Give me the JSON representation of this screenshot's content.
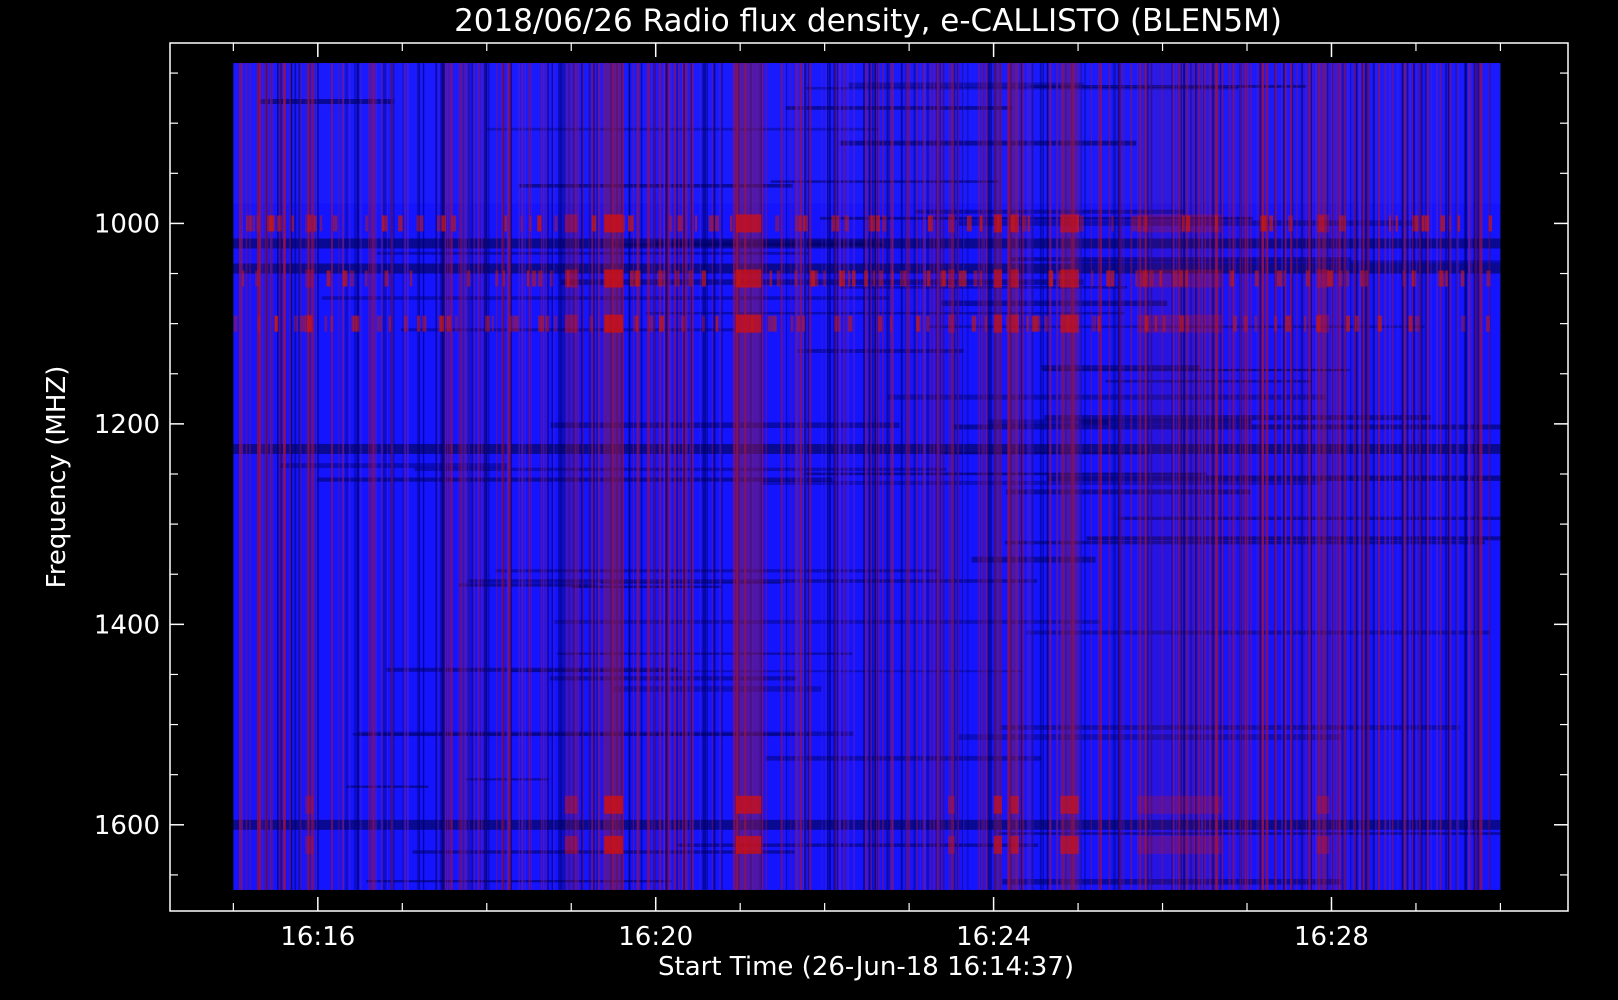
{
  "chart_data": {
    "type": "heatmap",
    "title": "2018/06/26  Radio flux density, e-CALLISTO (BLEN5M)",
    "xlabel": "Start Time (26-Jun-18 16:14:37)",
    "ylabel": "Frequency (MHZ)",
    "x_ticks": [
      "16:16",
      "16:20",
      "16:24",
      "16:28"
    ],
    "x_tick_minutes": [
      16,
      20,
      24,
      28
    ],
    "x_minor_minutes": [
      15,
      17,
      18,
      19,
      21,
      22,
      23,
      25,
      26,
      27,
      29,
      30
    ],
    "xlim_minutes": [
      14.25,
      30.8
    ],
    "data_x_range_minutes": [
      15,
      30
    ],
    "y_ticks": [
      "1000",
      "1200",
      "1400",
      "1600"
    ],
    "y_tick_values": [
      1000,
      1200,
      1400,
      1600
    ],
    "y_minor_values": [
      850,
      900,
      950,
      1050,
      1100,
      1150,
      1250,
      1300,
      1350,
      1450,
      1500,
      1550,
      1650
    ],
    "ylim": [
      820,
      1686
    ],
    "data_y_range": [
      840,
      1665
    ],
    "y_inverted": true,
    "colormap": {
      "low": "#000010",
      "mid": "#1414ff",
      "high": "#d01010"
    },
    "bright_time_bands_minutes": [
      {
        "center": 19.5,
        "width": 0.22,
        "intensity": 0.95
      },
      {
        "center": 21.1,
        "width": 0.3,
        "intensity": 0.9
      },
      {
        "center": 24.05,
        "width": 0.1,
        "intensity": 0.8
      },
      {
        "center": 24.25,
        "width": 0.1,
        "intensity": 0.8
      },
      {
        "center": 24.9,
        "width": 0.22,
        "intensity": 0.8
      },
      {
        "center": 19.0,
        "width": 0.15,
        "intensity": 0.55
      },
      {
        "center": 27.9,
        "width": 0.15,
        "intensity": 0.45
      },
      {
        "center": 26.2,
        "width": 1.0,
        "intensity": 0.3
      },
      {
        "center": 15.9,
        "width": 0.1,
        "intensity": 0.4
      },
      {
        "center": 23.5,
        "width": 0.08,
        "intensity": 0.5
      }
    ],
    "bright_frequency_rows_mhz": [
      1000,
      1055,
      1100,
      1580,
      1620
    ],
    "dark_frequency_rows_mhz": [
      1020,
      1045,
      1225,
      1600
    ]
  }
}
